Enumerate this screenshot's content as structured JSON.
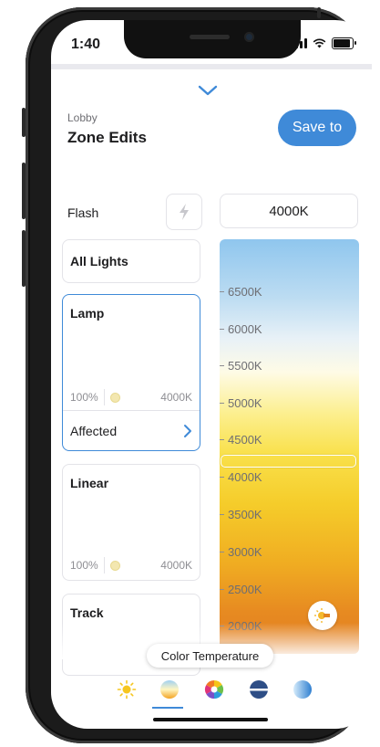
{
  "status_bar": {
    "time": "1:40"
  },
  "header": {
    "subtitle": "Lobby",
    "title": "Zone Edits",
    "save_label": "Save to"
  },
  "flash": {
    "label": "Flash"
  },
  "kelvin_readout": "4000K",
  "zones": [
    {
      "name": "All Lights"
    },
    {
      "name": "Lamp",
      "brightness": "100%",
      "kelvin": "4000K",
      "affected_label": "Affected",
      "selected": true
    },
    {
      "name": "Linear",
      "brightness": "100%",
      "kelvin": "4000K"
    },
    {
      "name": "Track"
    }
  ],
  "color_temperature_scale": {
    "ticks": [
      "6500K",
      "6000K",
      "5500K",
      "5000K",
      "4500K",
      "4000K",
      "3500K",
      "3000K",
      "2500K",
      "2000K"
    ],
    "selected": "4000K"
  },
  "tooltip": "Color Temperature",
  "bottom_tabs": [
    {
      "icon": "brightness-sun-icon"
    },
    {
      "icon": "color-temperature-icon",
      "active": true
    },
    {
      "icon": "color-wheel-icon"
    },
    {
      "icon": "saturation-icon"
    },
    {
      "icon": "gradient-icon"
    }
  ],
  "colors": {
    "accent": "#3f8ad8",
    "warm": "#e17d22",
    "cool": "#8fc6ee"
  }
}
